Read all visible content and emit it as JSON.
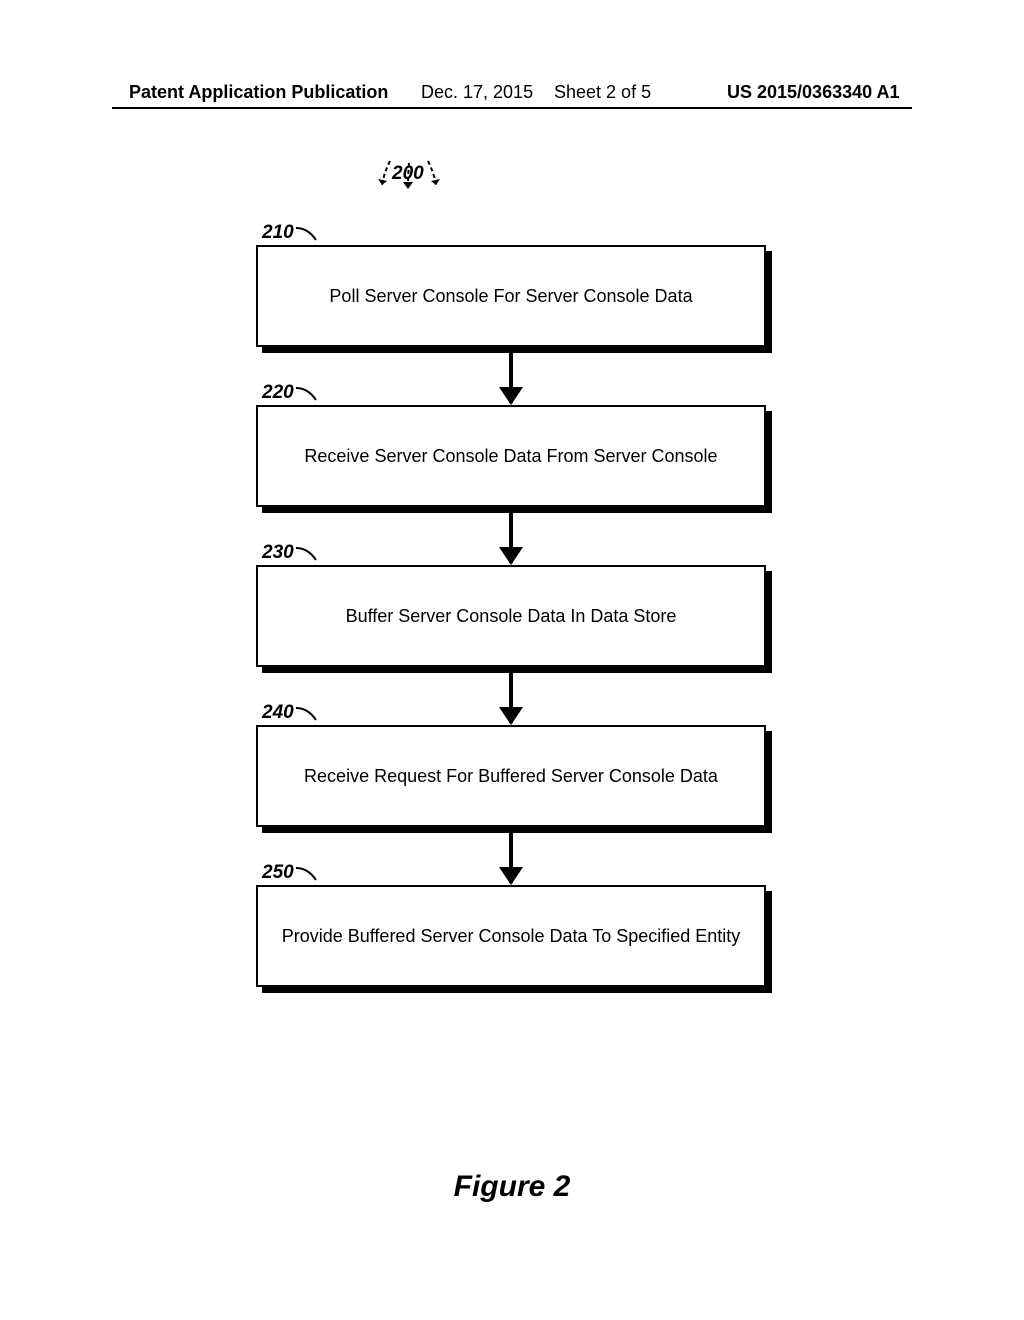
{
  "header": {
    "pub_label": "Patent Application Publication",
    "pub_date": "Dec. 17, 2015",
    "sheet": "Sheet 2 of 5",
    "pub_number": "US 2015/0363340 A1"
  },
  "diagram": {
    "overall_ref": "200",
    "figure_caption": "Figure 2",
    "steps": [
      {
        "ref": "210",
        "text": "Poll Server Console For Server Console Data"
      },
      {
        "ref": "220",
        "text": "Receive Server Console Data From Server Console"
      },
      {
        "ref": "230",
        "text": "Buffer Server Console Data In Data Store"
      },
      {
        "ref": "240",
        "text": "Receive Request For Buffered Server Console Data"
      },
      {
        "ref": "250",
        "text": "Provide Buffered Server Console Data To Specified Entity"
      }
    ]
  },
  "chart_data": {
    "type": "diagram",
    "title": "Figure 2",
    "overall_reference": "200",
    "sequence": [
      {
        "id": "210",
        "label": "Poll Server Console For Server Console Data"
      },
      {
        "id": "220",
        "label": "Receive Server Console Data From Server Console"
      },
      {
        "id": "230",
        "label": "Buffer Server Console Data In Data Store"
      },
      {
        "id": "240",
        "label": "Receive Request For Buffered Server Console Data"
      },
      {
        "id": "250",
        "label": "Provide Buffered Server Console Data To Specified Entity"
      }
    ],
    "edges": [
      [
        "210",
        "220"
      ],
      [
        "220",
        "230"
      ],
      [
        "230",
        "240"
      ],
      [
        "240",
        "250"
      ]
    ]
  }
}
